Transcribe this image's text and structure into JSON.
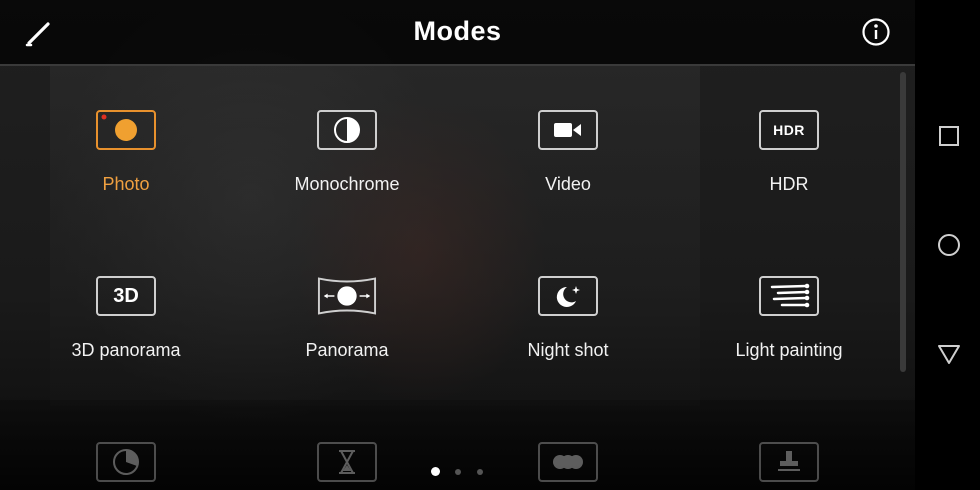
{
  "header": {
    "title": "Modes",
    "edit_icon": "pencil-icon",
    "info_icon": "info-icon"
  },
  "modes": [
    {
      "label": "Photo",
      "icon": "photo-shutter-icon",
      "selected": true
    },
    {
      "label": "Monochrome",
      "icon": "monochrome-icon",
      "selected": false
    },
    {
      "label": "Video",
      "icon": "video-camera-icon",
      "selected": false
    },
    {
      "label": "HDR",
      "icon": "hdr-icon",
      "icon_text": "HDR",
      "selected": false
    },
    {
      "label": "3D panorama",
      "icon": "3d-icon",
      "icon_text": "3D",
      "selected": false
    },
    {
      "label": "Panorama",
      "icon": "panorama-icon",
      "selected": false
    },
    {
      "label": "Night shot",
      "icon": "night-moon-icon",
      "selected": false
    },
    {
      "label": "Light painting",
      "icon": "light-painting-icon",
      "selected": false
    }
  ],
  "next_row_icons": [
    "timelapse-icon",
    "hourglass-icon",
    "filter-circles-icon",
    "stamp-icon"
  ],
  "pagination": {
    "pages": 3,
    "current": 1
  },
  "nav_bar": {
    "recents_icon": "square-icon",
    "home_icon": "circle-icon",
    "back_icon": "triangle-back-icon"
  },
  "colors": {
    "accent": "#e8912d",
    "active_label": "#f0a040",
    "record_dot": "#e03020"
  }
}
